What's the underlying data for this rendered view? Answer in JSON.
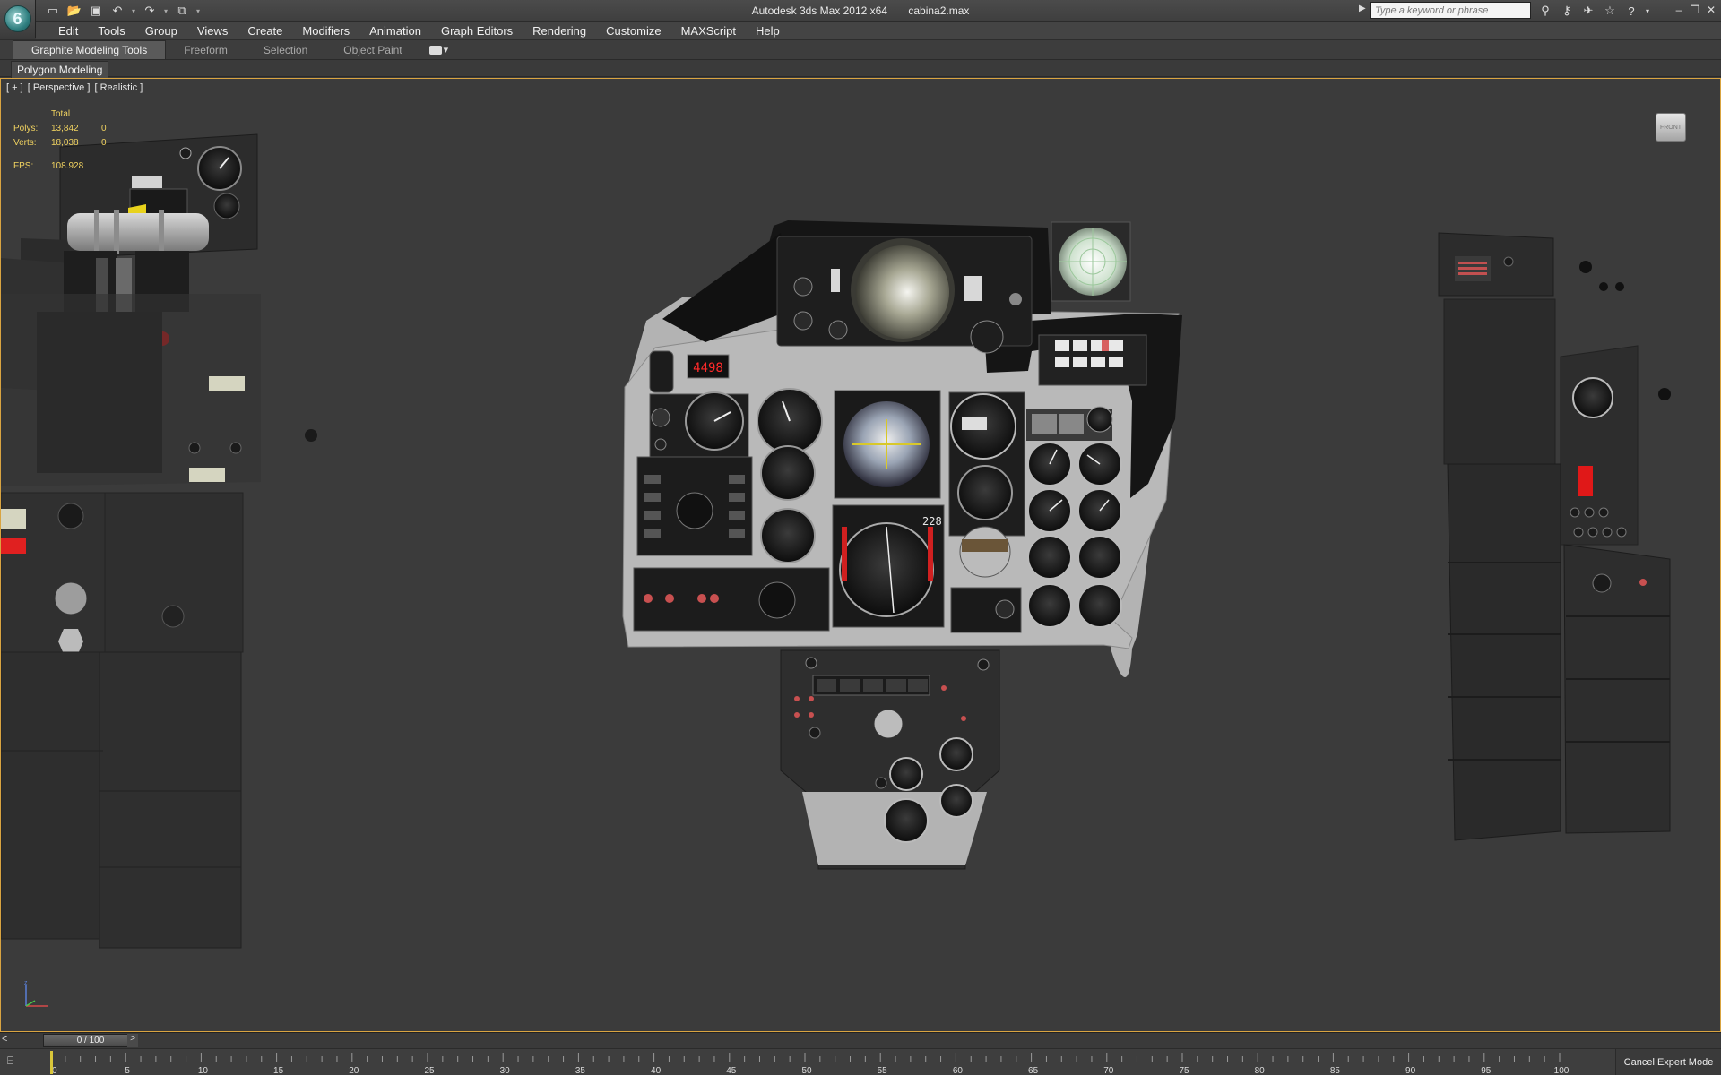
{
  "title_bar": {
    "app_name": "Autodesk 3ds Max  2012 x64",
    "file_name": "cabina2.max",
    "search_placeholder": "Type a keyword or phrase",
    "logo_letter": "6"
  },
  "quick_access": [
    "new-file-icon",
    "open-file-icon",
    "save-icon",
    "undo-icon",
    "redo-icon",
    "project-folder-icon"
  ],
  "menu": [
    "Edit",
    "Tools",
    "Group",
    "Views",
    "Create",
    "Modifiers",
    "Animation",
    "Graph Editors",
    "Rendering",
    "Customize",
    "MAXScript",
    "Help"
  ],
  "ribbon": {
    "tabs": [
      "Graphite Modeling Tools",
      "Freeform",
      "Selection",
      "Object Paint"
    ],
    "active_tab": "Graphite Modeling Tools",
    "panel": "Polygon Modeling"
  },
  "viewport": {
    "label_plus": "[ + ]",
    "label_view": "[ Perspective ]",
    "label_shading": "[ Realistic ]",
    "stats": {
      "total_label": "Total",
      "polys_label": "Polys:",
      "polys_total": "13,842",
      "polys_sel": "0",
      "verts_label": "Verts:",
      "verts_total": "18,038",
      "verts_sel": "0",
      "fps_label": "FPS:",
      "fps_value": "108.928"
    },
    "viewcube_label": "FRONT",
    "instrument_readout": "4498",
    "hsi_value": "228"
  },
  "timeline": {
    "frame_display": "0 / 100",
    "ticks": [
      0,
      5,
      10,
      15,
      20,
      25,
      30,
      35,
      40,
      45,
      50,
      55,
      60,
      65,
      70,
      75,
      80,
      85,
      90,
      95,
      100
    ],
    "current_frame": 0
  },
  "status": {
    "expert_mode": "Cancel Expert Mode"
  },
  "colors": {
    "viewport_border": "#d9a441",
    "stats_text": "#f0d260",
    "panel_grey": "#b3b3b3",
    "warning_red": "#e01818"
  }
}
